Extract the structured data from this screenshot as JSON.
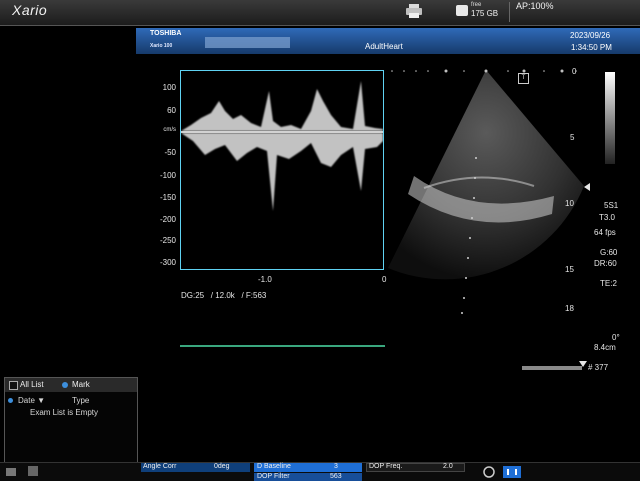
{
  "top_bar": {
    "brand": "Xario",
    "disk_label": "free",
    "disk_value": "175 GB",
    "ap": "AP:100%"
  },
  "banner": {
    "manufacturer": "TOSHIBA",
    "model": "Xario 100",
    "preset": "AdultHeart",
    "date": "2023/09/26",
    "time": "1:34:50 PM"
  },
  "doppler": {
    "v_unit": "cm/s",
    "v_ticks": [
      "100",
      "60",
      "-50",
      "-100",
      "-150",
      "-200",
      "-250",
      "-300"
    ],
    "h_ticks": [
      "-1.0",
      "0"
    ],
    "params": "DG:25   / 12.0k   / F:563"
  },
  "imaging": {
    "depth_ticks": [
      "0",
      "5",
      "10",
      "15",
      "18"
    ],
    "probe": "5S1",
    "tis": "T3.0",
    "fps": "64 fps",
    "gain": "G:60",
    "dr": "DR:60",
    "te": "TE:2",
    "angle": "0°",
    "depth": "8.4cm",
    "frame_count": "# 377",
    "t_label": "T"
  },
  "exam_list": {
    "all_list": "All List",
    "mark": "Mark",
    "col_date": "Date",
    "col_type": "Type",
    "empty_msg": "Exam List is Empty"
  },
  "controls": {
    "angle_corr_label": "Angle Corr",
    "angle_corr_value": "0deg",
    "d_baseline_label": "D Baseline",
    "d_baseline_value": "3",
    "dop_filter_label": "DOP Filter",
    "dop_filter_value": "563",
    "dop_freq_label": "DOP Freq.",
    "dop_freq_value": "2.0"
  },
  "colors": {
    "doppler_frame": "#5fd2f2",
    "banner_top": "#2f6ab8",
    "ecg": "#3aa77e"
  }
}
